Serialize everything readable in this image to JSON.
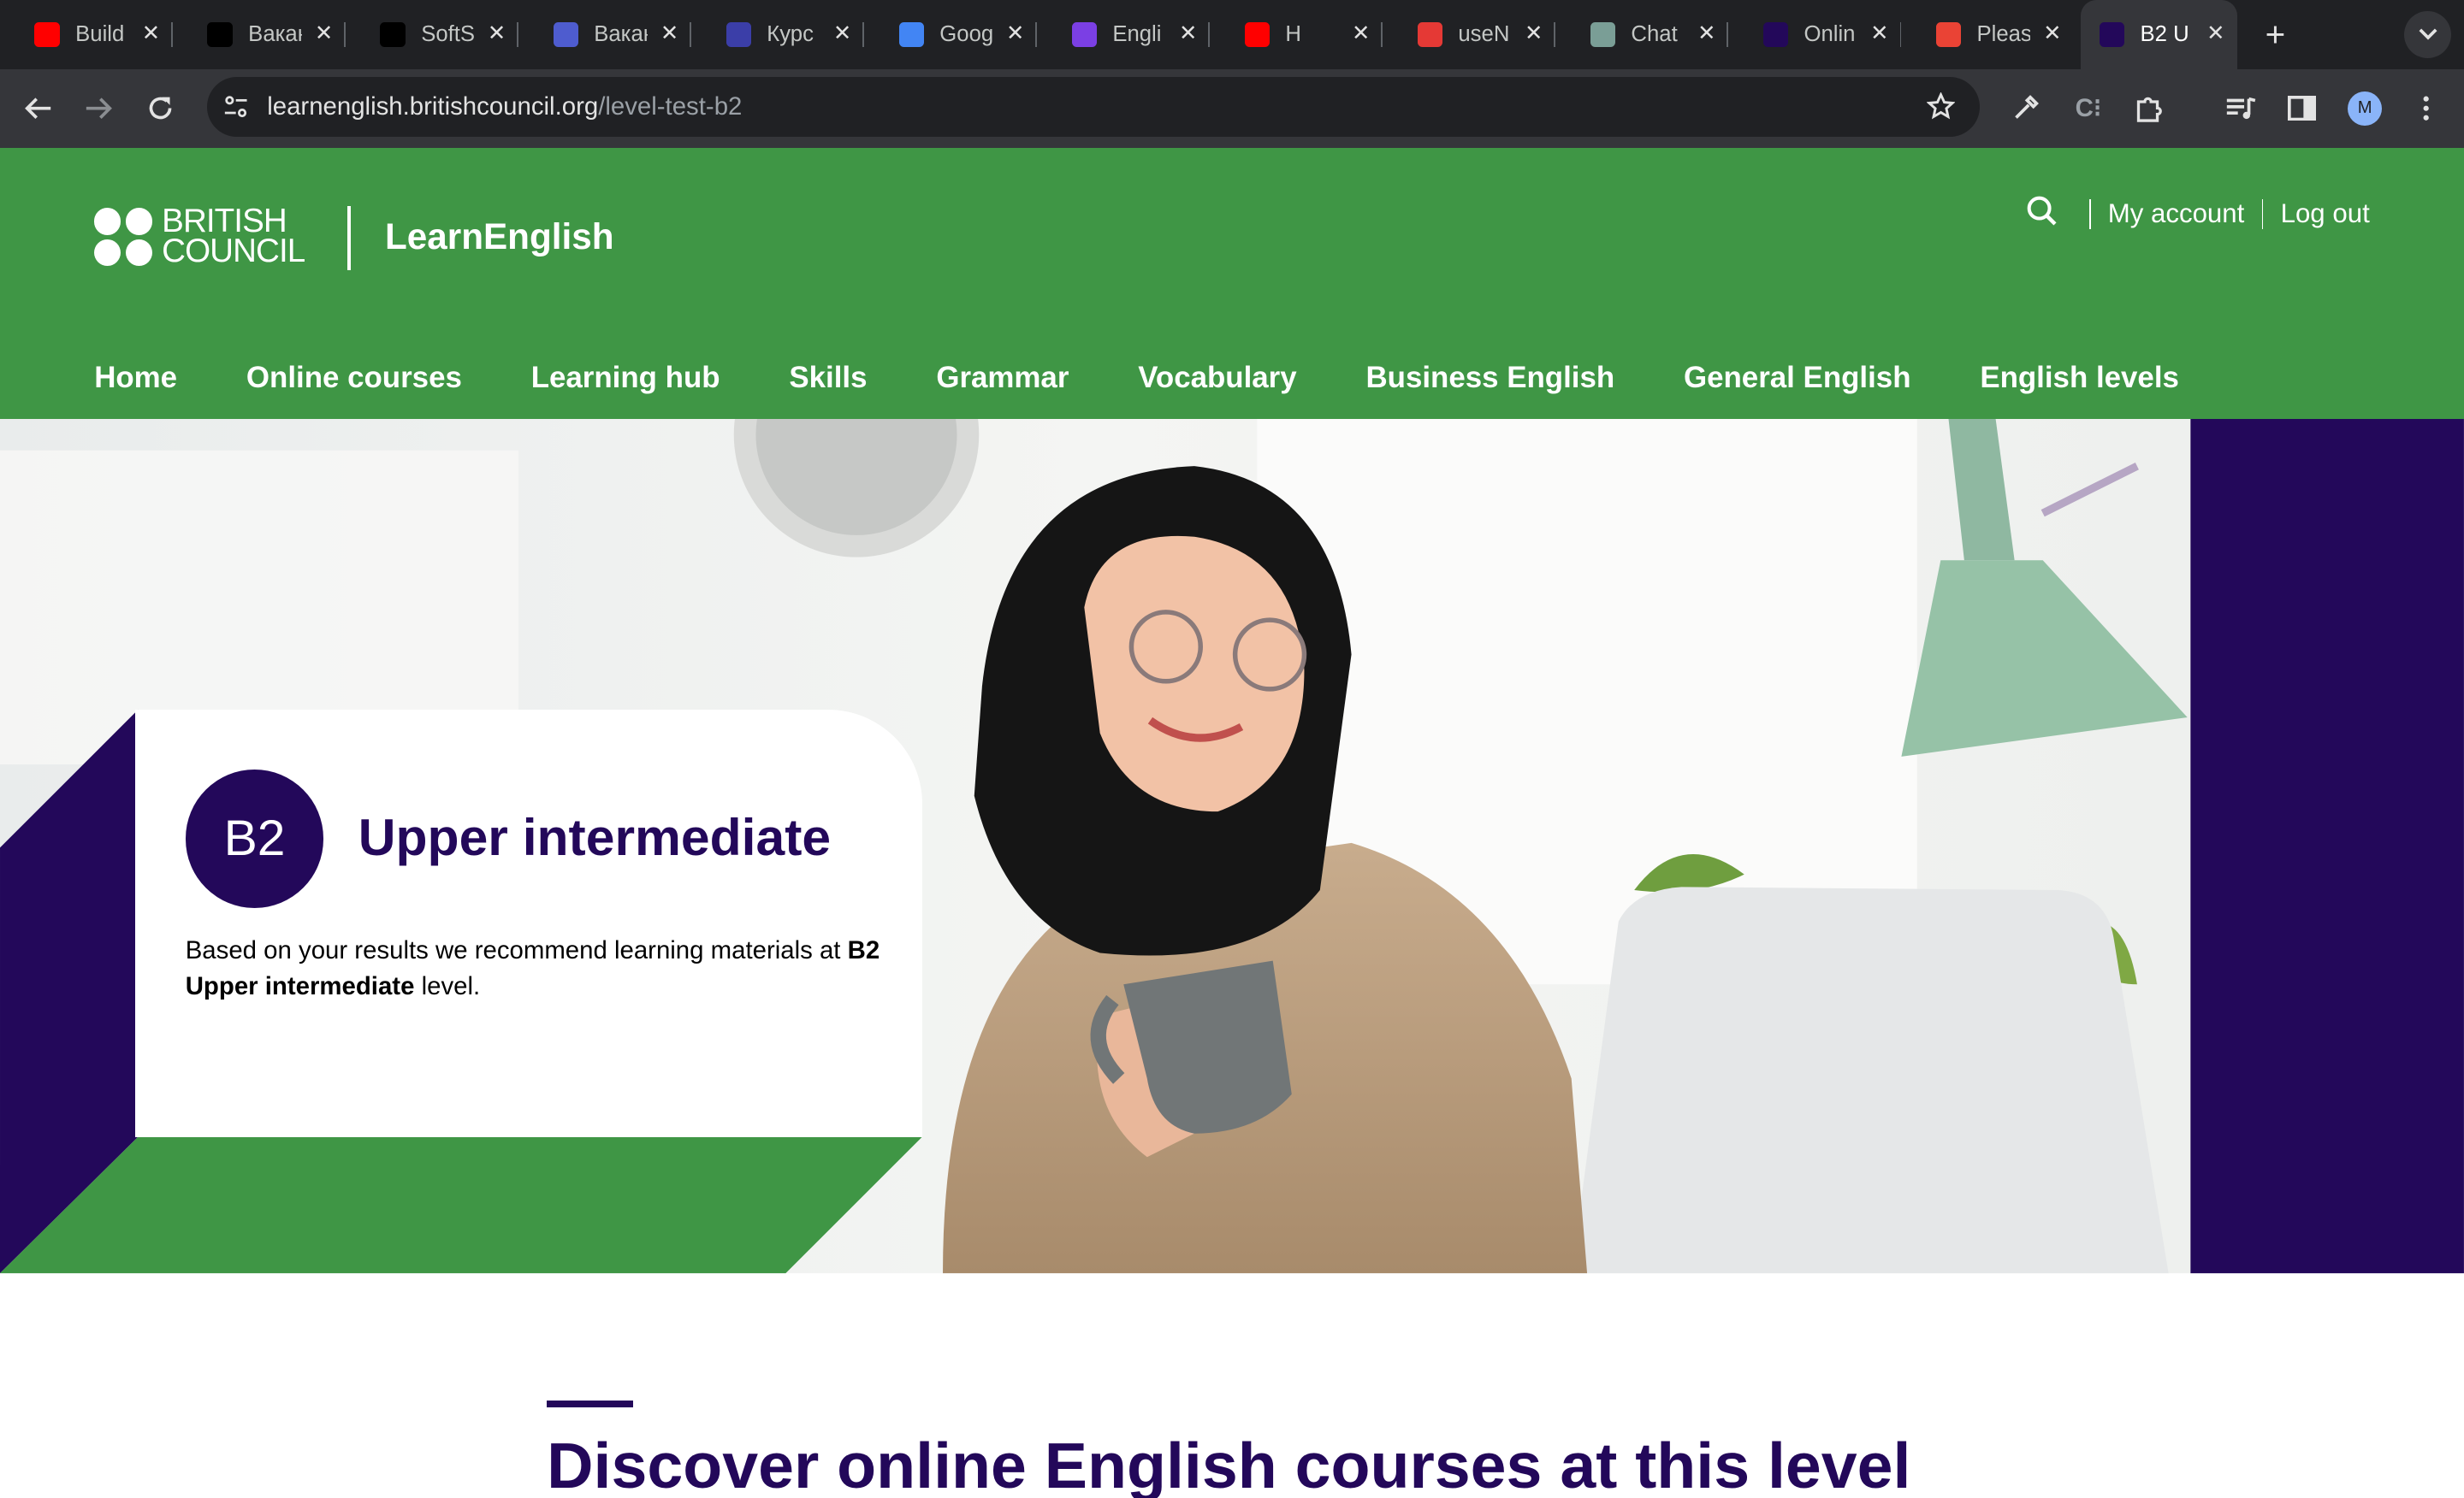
{
  "browser": {
    "tabs": [
      {
        "title": "Build",
        "favicon": "youtube-icon",
        "color": "#ff0000"
      },
      {
        "title": "Вакан",
        "favicon": "dou-icon",
        "color": "#000000"
      },
      {
        "title": "SoftS",
        "favicon": "s-icon",
        "color": "#000000"
      },
      {
        "title": "Вакан",
        "favicon": "djinni-icon",
        "color": "#4e5ccf"
      },
      {
        "title": "Курс",
        "favicon": "course-icon",
        "color": "#3b3ea8"
      },
      {
        "title": "Goog",
        "favicon": "google-translate-icon",
        "color": "#4285f4"
      },
      {
        "title": "Engli",
        "favicon": "english-icon",
        "color": "#7b3fe4"
      },
      {
        "title": "H",
        "favicon": "youtube-icon",
        "color": "#ff0000"
      },
      {
        "title": "useN",
        "favicon": "usen-icon",
        "color": "#e53935"
      },
      {
        "title": "Chat",
        "favicon": "chatgpt-icon",
        "color": "#7a9e96"
      },
      {
        "title": "Onlin",
        "favicon": "british-council-icon",
        "color": "#23085a"
      },
      {
        "title": "Pleas",
        "favicon": "gmail-icon",
        "color": "#ea4335"
      },
      {
        "title": "B2 U",
        "favicon": "british-council-icon",
        "color": "#23085a"
      }
    ],
    "new_tab": "+",
    "address": {
      "domain": "learnenglish.britishcouncil.org",
      "path": "/level-test-b2"
    },
    "profile_initial": "M"
  },
  "site": {
    "brand_line1": "BRITISH",
    "brand_line2": "COUNCIL",
    "name": "LearnEnglish",
    "util": {
      "account": "My account",
      "logout": "Log out"
    },
    "nav": [
      "Home",
      "Online courses",
      "Learning hub",
      "Skills",
      "Grammar",
      "Vocabulary",
      "Business English",
      "General English",
      "English levels"
    ]
  },
  "level": {
    "code": "B2",
    "title": "Upper intermediate",
    "desc_prefix": "Based on your results we recommend learning materials at",
    "desc_bold": "B2 Upper intermediate",
    "desc_suffix": " level."
  },
  "discover": {
    "title": "Discover online English courses at this level"
  },
  "colors": {
    "green": "#3f9645",
    "purple": "#23085a",
    "chrome_dark": "#202124",
    "chrome_toolbar": "#35363a"
  }
}
